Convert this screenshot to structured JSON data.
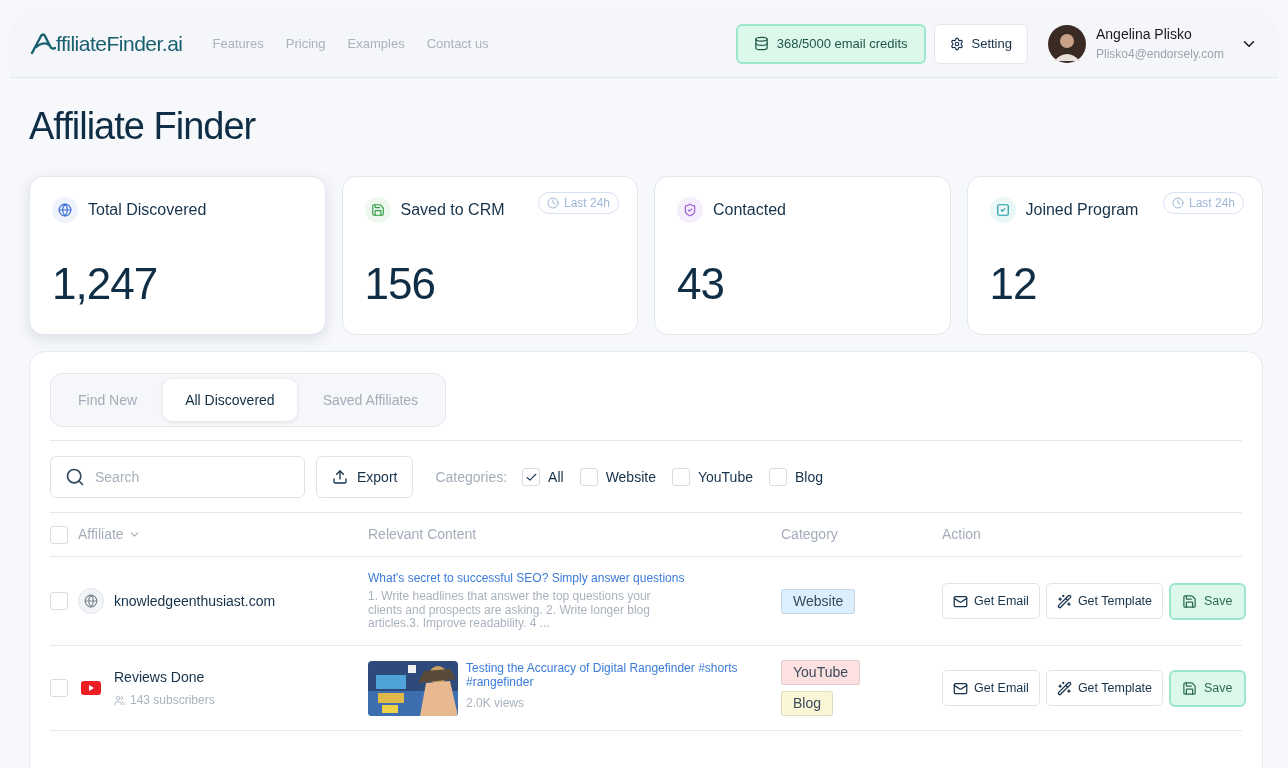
{
  "nav": {
    "logo_text": "ffiliateFinder.ai",
    "links": [
      "Features",
      "Pricing",
      "Examples",
      "Contact us"
    ],
    "credits": "368/5000 email credits",
    "setting": "Setting",
    "user": {
      "name": "Angelina Plisko",
      "email": "Plisko4@endorsely.com"
    }
  },
  "page_title": "Affiliate Finder",
  "stats": [
    {
      "kind": "globe",
      "label": "Total Discovered",
      "value": "1,247",
      "raised": true
    },
    {
      "kind": "save",
      "label": "Saved to CRM",
      "value": "156",
      "badge": "Last 24h",
      "raised": false
    },
    {
      "kind": "contact",
      "label": "Contacted",
      "value": "43",
      "raised": false
    },
    {
      "kind": "check",
      "label": "Joined Program",
      "value": "12",
      "badge": "Last 24h",
      "raised": false
    }
  ],
  "tabs": [
    {
      "label": "Find New",
      "selected": false
    },
    {
      "label": "All Discovered",
      "selected": true
    },
    {
      "label": "Saved Affiliates",
      "selected": false
    }
  ],
  "search": {
    "placeholder": "Search"
  },
  "export": "Export",
  "categories_label": "Categories:",
  "categories": [
    {
      "label": "All",
      "checked": true
    },
    {
      "label": "Website",
      "checked": false
    },
    {
      "label": "YouTube",
      "checked": false
    },
    {
      "label": "Blog",
      "checked": false
    }
  ],
  "table": {
    "all_checked": false,
    "columns": [
      "Affiliate",
      "Relevant Content",
      "Category",
      "Action"
    ],
    "rows": [
      {
        "kind": "website",
        "checked": false,
        "name": "knowledgeenthusiast.com",
        "content_title": "What's secret to successful SEO? Simply answer questions",
        "content_text": "1. Write headlines that answer the top questions your clients and prospects are asking. 2. Write longer blog articles.3. Improve readability. 4 ...",
        "categories": [
          {
            "label": "Website",
            "color": "#dcefff"
          }
        ],
        "actions": [
          "Get Email",
          "Get Template",
          "Save"
        ],
        "faded": false
      },
      {
        "kind": "youtube",
        "checked": false,
        "name": "Reviews Done",
        "subtitle": "143 subscribers",
        "content_title": "Testing the Accuracy of Digital Rangefinder #shorts #rangefinder",
        "views": "2.0K views",
        "categories": [
          {
            "label": "YouTube",
            "color": "#fde0e0"
          },
          {
            "label": "Blog",
            "color": "#fbf7d6"
          }
        ],
        "actions": [
          "Get Email",
          "Get Template",
          "Save"
        ],
        "faded": false
      }
    ]
  }
}
